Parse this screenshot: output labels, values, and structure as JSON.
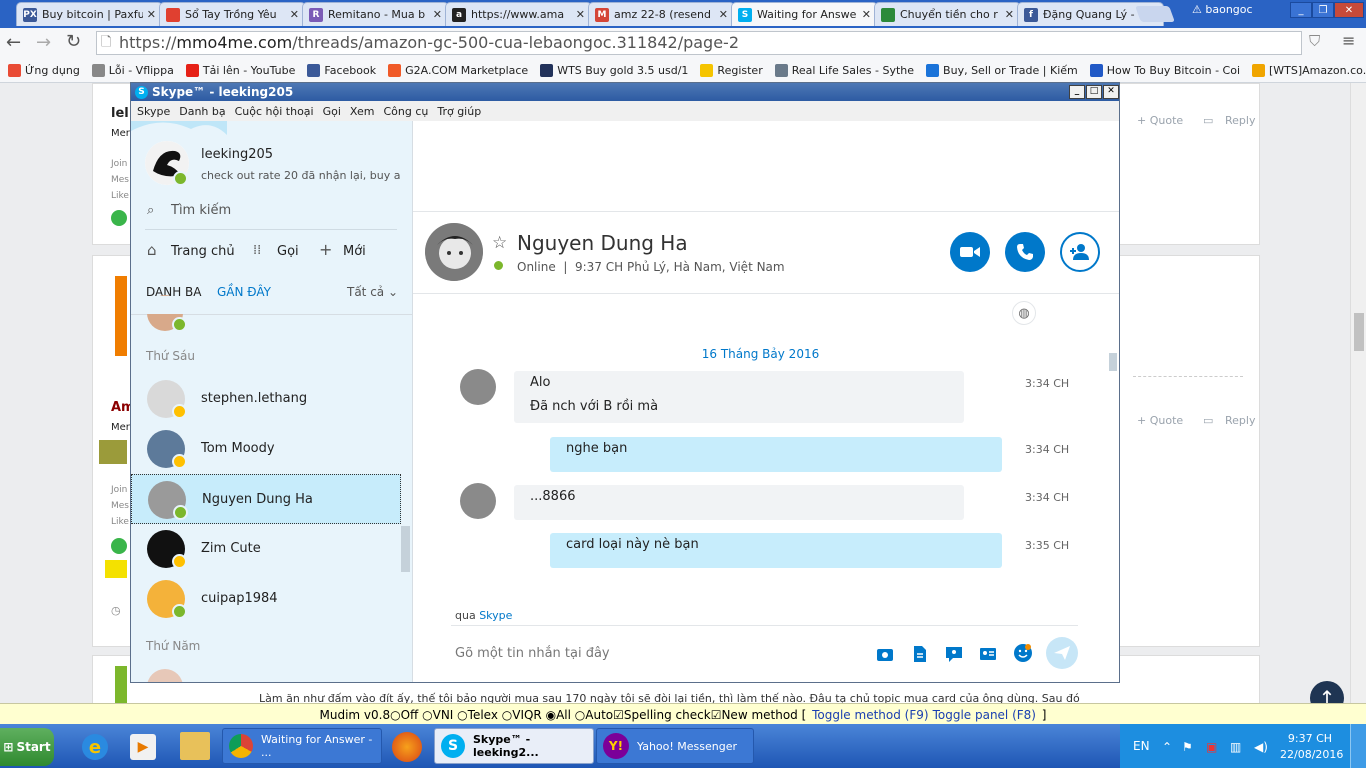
{
  "browser": {
    "tabs": [
      {
        "title": "Buy bitcoin | Paxfu",
        "icon_color": "#3b5998",
        "icon_text": "PX"
      },
      {
        "title": "Sổ Tay Trồng Yêu",
        "icon_color": "#e04030",
        "icon_text": ""
      },
      {
        "title": "Remitano - Mua b",
        "icon_color": "#7b5bb6",
        "icon_text": "R"
      },
      {
        "title": "https://www.ama",
        "icon_color": "#222222",
        "icon_text": "a"
      },
      {
        "title": "amz 22-8 (resend",
        "icon_color": "#d44638",
        "icon_text": "M"
      },
      {
        "title": "Waiting for Answe",
        "icon_color": "#00aff0",
        "icon_text": "S"
      },
      {
        "title": "Chuyển tiền cho r",
        "icon_color": "#2c8a3a",
        "icon_text": ""
      },
      {
        "title": "Đặng Quang Lý -",
        "icon_color": "#3b5998",
        "icon_text": "f"
      }
    ],
    "profile_name": "baongoc",
    "url_prefix": "https://",
    "url_host": "mmo4me.com",
    "url_path": "/threads/amazon-gc-500-cua-lebaongoc.311842/page-2",
    "bookmarks": [
      {
        "label": "Ứng dụng",
        "color": "#e94b35"
      },
      {
        "label": "Lỗi - Vflippa",
        "color": "#888888"
      },
      {
        "label": "Tải lên - YouTube",
        "color": "#e62117"
      },
      {
        "label": "Facebook",
        "color": "#3b5998"
      },
      {
        "label": "G2A.COM Marketplace",
        "color": "#f05a28"
      },
      {
        "label": "WTS Buy gold 3.5 usd/1",
        "color": "#22325a"
      },
      {
        "label": "Register",
        "color": "#f5c400"
      },
      {
        "label": "Real Life Sales - Sythe",
        "color": "#6a7a8a"
      },
      {
        "label": "Buy, Sell or Trade | Kiếm",
        "color": "#1a73d9"
      },
      {
        "label": "How To Buy Bitcoin - Coi",
        "color": "#2159c6"
      },
      {
        "label": "[WTS]Amazon.co.uk Acc",
        "color": "#f0a500"
      }
    ]
  },
  "webpage": {
    "quote_label": "+ Quote",
    "reply_label": "Reply",
    "post_text": "Làm ăn như đấm vào đít ấy, thế tôi bảo người mua sau 170 ngày tôi sẽ đòi lại tiền, thì làm thế nào. Đâu tạ chủ topic mua card của ông dùng. Sau đó"
  },
  "skype": {
    "window_title": "Skype™ - leeking205",
    "menu": [
      "Skype",
      "Danh bạ",
      "Cuộc hội thoại",
      "Gọi",
      "Xem",
      "Công cụ",
      "Trợ giúp"
    ],
    "profile": {
      "username": "leeking205",
      "mood": "check out rate 20 đã nhận lại, buy a..."
    },
    "search_placeholder": "Tìm kiếm",
    "nav": {
      "home": "Trang chủ",
      "call": "Gọi",
      "new": "Mới"
    },
    "list_tabs": {
      "contacts": "DANH BẠ",
      "recent": "GẦN ĐÂY",
      "filter": "Tất cả"
    },
    "day_headers": [
      "Thứ Sáu",
      "Thứ Năm"
    ],
    "contacts": [
      {
        "name": "stephen.lethang",
        "status": "away"
      },
      {
        "name": "Tom Moody",
        "status": "away"
      },
      {
        "name": "Nguyen Dung Ha",
        "status": "online",
        "selected": true
      },
      {
        "name": "Zim Cute",
        "status": "away"
      },
      {
        "name": "cuipap1984",
        "status": "online"
      }
    ],
    "conversation": {
      "name": "Nguyen Dung Ha",
      "status_line": "Online  |  9:37 CH Phủ Lý, Hà Nam, Việt Nam",
      "date_divider": "16 Tháng Bảy 2016",
      "messages": [
        {
          "dir": "in",
          "lines": [
            "Alo",
            "Đã nch với B rồi mà"
          ],
          "time": "3:34 CH"
        },
        {
          "dir": "out",
          "lines": [
            "nghe bạn"
          ],
          "time": "3:34 CH"
        },
        {
          "dir": "in",
          "lines": [
            "...8866"
          ],
          "time": "3:34 CH"
        },
        {
          "dir": "out",
          "lines": [
            "card loại này nè bạn"
          ],
          "time": "3:35 CH"
        }
      ],
      "via_prefix": "qua",
      "via_link": "Skype",
      "compose_placeholder": "Gõ một tin nhắn tại đây"
    },
    "colors": {
      "accent": "#00aff0",
      "button_blue": "#0078ca",
      "online": "#7cb72c",
      "away": "#ffc000"
    }
  },
  "ime": {
    "app": "Mudim v0.8",
    "options": [
      "Off",
      "VNI",
      "Telex",
      "VIQR",
      "All",
      "Auto"
    ],
    "spelling": "Spelling check",
    "new_method": "New method",
    "toggle_method": "Toggle method (F9)",
    "toggle_panel": "Toggle panel (F8)"
  },
  "taskbar": {
    "start": "Start",
    "tasks": [
      {
        "label": "Waiting for Answer - ...",
        "active": false
      },
      {
        "label": "Skype™ - leeking2...",
        "active": true
      },
      {
        "label": "Yahoo! Messenger",
        "active": false
      }
    ],
    "language": "EN",
    "time": "9:37 CH",
    "date": "22/08/2016"
  }
}
